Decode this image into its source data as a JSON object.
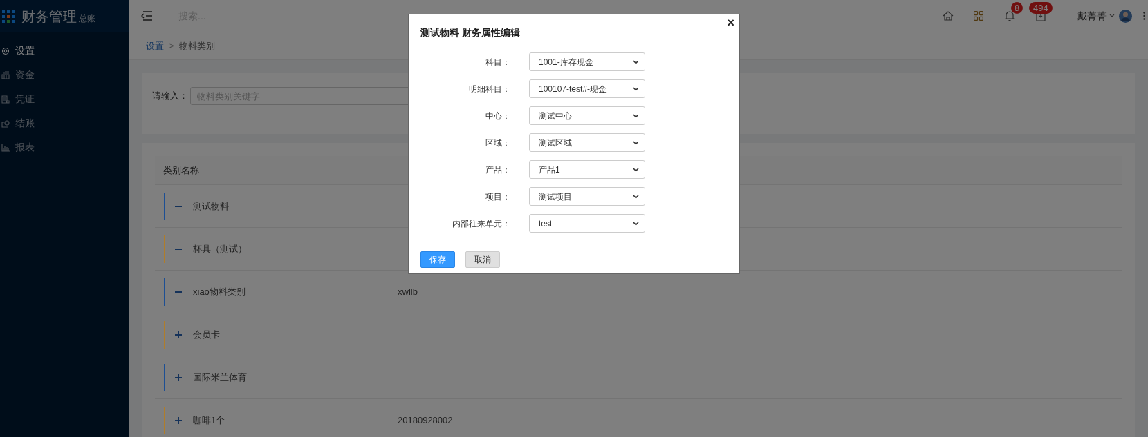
{
  "sidebar": {
    "logo": {
      "title": "财务管理",
      "subtitle": "总账"
    },
    "items": [
      {
        "label": "设置",
        "selected": true
      },
      {
        "label": "资金",
        "selected": false
      },
      {
        "label": "凭证",
        "selected": false
      },
      {
        "label": "结账",
        "selected": false
      },
      {
        "label": "报表",
        "selected": false
      }
    ]
  },
  "topbar": {
    "search": {
      "placeholder": "搜索..."
    },
    "notifications": "8",
    "messages": "494",
    "user": "戴菁菁"
  },
  "breadcrumb": {
    "items": [
      "设置",
      "物料类别"
    ],
    "separator": ">"
  },
  "filter": {
    "label": "请输入：",
    "placeholder": "物料类别关键字"
  },
  "table": {
    "columns": [
      "类别名称"
    ],
    "rows": [
      {
        "name": "测试物料",
        "expanded": true,
        "color": "#1d4f94"
      },
      {
        "name": "杯具（测试）",
        "expanded": true,
        "color": "#b07d2a"
      },
      {
        "name": "xiao物料类别",
        "code": "xwllb",
        "expanded": true,
        "color": "#1d4f94"
      },
      {
        "name": "会员卡",
        "expanded": false,
        "color": "#b07d2a"
      },
      {
        "name": "国际米兰体育",
        "expanded": false,
        "color": "#1d4f94"
      },
      {
        "name": "咖啡1个",
        "code": "20180928002",
        "expanded": false,
        "color": "#b07d2a"
      }
    ]
  },
  "modal": {
    "title": "测试物料 财务属性编辑",
    "close": "×",
    "fields": [
      {
        "label": "科目：",
        "value": "1001-库存现金"
      },
      {
        "label": "明细科目：",
        "value": "100107-test#-现金"
      },
      {
        "label": "中心：",
        "value": "测试中心"
      },
      {
        "label": "区域：",
        "value": "测试区域"
      },
      {
        "label": "产品：",
        "value": "产品1"
      },
      {
        "label": "项目：",
        "value": "测试项目"
      },
      {
        "label": "内部往来单元：",
        "value": "test"
      }
    ],
    "buttons": [
      {
        "label": "保存",
        "kind": "primary"
      },
      {
        "label": "取消",
        "kind": "secondary"
      }
    ]
  }
}
